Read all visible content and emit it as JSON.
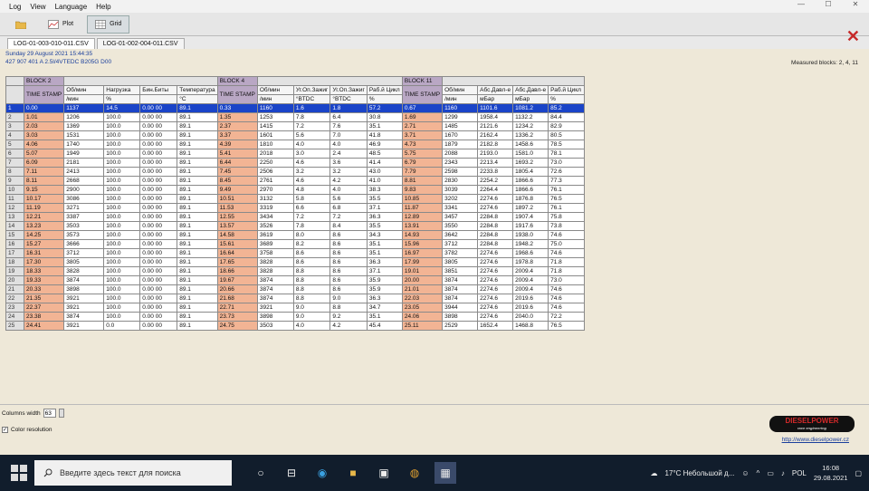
{
  "menu": [
    "Log",
    "View",
    "Language",
    "Help"
  ],
  "toolbar": {
    "plot": "Plot",
    "grid": "Grid"
  },
  "tabs": [
    "LOG-01-003-010-011.CSV",
    "LOG-01-002-004-011.CSV"
  ],
  "info": {
    "date": "Sunday 29 August 2021 15:44:35",
    "engine": "427 907 401 A  2.5l/4VTEDC B205G D00"
  },
  "measured_blocks": "Measured blocks: 2, 4, 11",
  "blocks": {
    "b2": "BLOCK 2",
    "b4": "BLOCK 4",
    "b11": "BLOCK 11"
  },
  "headers": [
    "TIME STAMP",
    "Об/мин",
    "Нагрузка",
    "Бин.Биты",
    "Температура",
    "TIME STAMP",
    "Об/мин",
    "Уг.Оп.Зажиг",
    "Уг.Оп.Зажиг",
    "Раб.й Цикл",
    "TIME STAMP",
    "Об/мин",
    "Абс.Давл-е",
    "Абс.Давл-е",
    "Раб.й Цикл"
  ],
  "units": [
    "",
    "/мин",
    "%",
    "",
    "°C",
    "",
    "/мин",
    "°BTDC",
    "°BTDC",
    "%",
    "",
    "/мин",
    "мБар",
    "мБар",
    "%"
  ],
  "rows": [
    [
      "0.00",
      "1137",
      "14.5",
      "0.00 00",
      "89.1",
      "0.33",
      "1160",
      "1.6",
      "1.8",
      "57.2",
      "0.67",
      "1160",
      "1101.6",
      "1081.2",
      "85.2"
    ],
    [
      "1.01",
      "1206",
      "100.0",
      "0.00 00",
      "89.1",
      "1.35",
      "1253",
      "7.8",
      "6.4",
      "30.8",
      "1.69",
      "1299",
      "1958.4",
      "1132.2",
      "84.4"
    ],
    [
      "2.03",
      "1369",
      "100.0",
      "0.00 00",
      "89.1",
      "2.37",
      "1415",
      "7.2",
      "7.6",
      "35.1",
      "2.71",
      "1485",
      "2121.6",
      "1234.2",
      "82.9"
    ],
    [
      "3.03",
      "1531",
      "100.0",
      "0.00 00",
      "89.1",
      "3.37",
      "1601",
      "5.6",
      "7.0",
      "41.8",
      "3.71",
      "1670",
      "2162.4",
      "1336.2",
      "80.5"
    ],
    [
      "4.06",
      "1740",
      "100.0",
      "0.00 00",
      "89.1",
      "4.39",
      "1810",
      "4.0",
      "4.0",
      "46.9",
      "4.73",
      "1879",
      "2182.8",
      "1458.6",
      "78.5"
    ],
    [
      "5.07",
      "1949",
      "100.0",
      "0.00 00",
      "89.1",
      "5.41",
      "2018",
      "3.0",
      "2.4",
      "48.5",
      "5.75",
      "2088",
      "2193.0",
      "1581.0",
      "78.1"
    ],
    [
      "6.09",
      "2181",
      "100.0",
      "0.00 00",
      "89.1",
      "6.44",
      "2250",
      "4.6",
      "3.6",
      "41.4",
      "6.79",
      "2343",
      "2213.4",
      "1693.2",
      "73.0"
    ],
    [
      "7.11",
      "2413",
      "100.0",
      "0.00 00",
      "89.1",
      "7.45",
      "2506",
      "3.2",
      "3.2",
      "43.0",
      "7.79",
      "2598",
      "2233.8",
      "1805.4",
      "72.6"
    ],
    [
      "8.11",
      "2668",
      "100.0",
      "0.00 00",
      "89.1",
      "8.45",
      "2761",
      "4.6",
      "4.2",
      "41.0",
      "8.81",
      "2830",
      "2254.2",
      "1866.6",
      "77.3"
    ],
    [
      "9.15",
      "2900",
      "100.0",
      "0.00 00",
      "89.1",
      "9.49",
      "2970",
      "4.8",
      "4.0",
      "38.3",
      "9.83",
      "3039",
      "2264.4",
      "1866.6",
      "76.1"
    ],
    [
      "10.17",
      "3086",
      "100.0",
      "0.00 00",
      "89.1",
      "10.51",
      "3132",
      "5.8",
      "5.6",
      "35.5",
      "10.85",
      "3202",
      "2274.6",
      "1876.8",
      "76.5"
    ],
    [
      "11.19",
      "3271",
      "100.0",
      "0.00 00",
      "89.1",
      "11.53",
      "3319",
      "6.6",
      "6.8",
      "37.1",
      "11.87",
      "3341",
      "2274.6",
      "1897.2",
      "76.1"
    ],
    [
      "12.21",
      "3387",
      "100.0",
      "0.00 00",
      "89.1",
      "12.55",
      "3434",
      "7.2",
      "7.2",
      "36.3",
      "12.89",
      "3457",
      "2284.8",
      "1907.4",
      "75.8"
    ],
    [
      "13.23",
      "3503",
      "100.0",
      "0.00 00",
      "89.1",
      "13.57",
      "3526",
      "7.8",
      "8.4",
      "35.5",
      "13.91",
      "3550",
      "2284.8",
      "1917.6",
      "73.8"
    ],
    [
      "14.25",
      "3573",
      "100.0",
      "0.00 00",
      "89.1",
      "14.58",
      "3619",
      "8.0",
      "8.6",
      "34.3",
      "14.93",
      "3642",
      "2284.8",
      "1938.0",
      "74.6"
    ],
    [
      "15.27",
      "3666",
      "100.0",
      "0.00 00",
      "89.1",
      "15.61",
      "3689",
      "8.2",
      "8.6",
      "35.1",
      "15.96",
      "3712",
      "2284.8",
      "1948.2",
      "75.0"
    ],
    [
      "16.31",
      "3712",
      "100.0",
      "0.00 00",
      "89.1",
      "16.64",
      "3758",
      "8.6",
      "8.6",
      "35.1",
      "16.97",
      "3782",
      "2274.6",
      "1968.6",
      "74.6"
    ],
    [
      "17.30",
      "3805",
      "100.0",
      "0.00 00",
      "89.1",
      "17.65",
      "3828",
      "8.6",
      "8.6",
      "36.3",
      "17.99",
      "3805",
      "2274.6",
      "1978.8",
      "71.8"
    ],
    [
      "18.33",
      "3828",
      "100.0",
      "0.00 00",
      "89.1",
      "18.66",
      "3828",
      "8.8",
      "8.6",
      "37.1",
      "19.01",
      "3851",
      "2274.6",
      "2009.4",
      "71.8"
    ],
    [
      "19.33",
      "3874",
      "100.0",
      "0.00 00",
      "89.1",
      "19.67",
      "3874",
      "8.8",
      "8.6",
      "35.9",
      "20.00",
      "3874",
      "2274.6",
      "2009.4",
      "73.0"
    ],
    [
      "20.33",
      "3898",
      "100.0",
      "0.00 00",
      "89.1",
      "20.66",
      "3874",
      "8.8",
      "8.6",
      "35.9",
      "21.01",
      "3874",
      "2274.6",
      "2009.4",
      "74.6"
    ],
    [
      "21.35",
      "3921",
      "100.0",
      "0.00 00",
      "89.1",
      "21.68",
      "3874",
      "8.8",
      "9.0",
      "36.3",
      "22.03",
      "3874",
      "2274.6",
      "2019.6",
      "74.6"
    ],
    [
      "22.37",
      "3921",
      "100.0",
      "0.00 00",
      "89.1",
      "22.71",
      "3921",
      "9.0",
      "8.8",
      "34.7",
      "23.05",
      "3944",
      "2274.6",
      "2019.6",
      "74.6"
    ],
    [
      "23.38",
      "3874",
      "100.0",
      "0.00 00",
      "89.1",
      "23.73",
      "3898",
      "9.0",
      "9.2",
      "35.1",
      "24.06",
      "3898",
      "2274.6",
      "2040.0",
      "72.2"
    ],
    [
      "24.41",
      "3921",
      "0.0",
      "0.00 00",
      "89.1",
      "24.75",
      "3503",
      "4.0",
      "4.2",
      "45.4",
      "25.11",
      "2529",
      "1652.4",
      "1468.8",
      "76.5"
    ]
  ],
  "column_width_label": "Columns width",
  "column_width_value": "63",
  "color_resolution": "Color resolution",
  "logo": {
    "name": "DIESELPOWER",
    "tagline": "race engineering"
  },
  "link": "http://www.dieselpower.cz",
  "taskbar": {
    "search_placeholder": "Введите здесь текст для поиска",
    "weather": "17°C  Небольшой д...",
    "lang": "POL",
    "time": "16:08",
    "date": "29.08.2021"
  }
}
